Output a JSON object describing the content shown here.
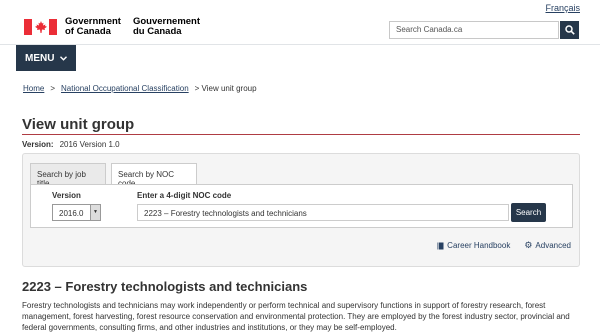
{
  "header": {
    "language_link": "Français",
    "brand_en_line1": "Government",
    "brand_en_line2": "of Canada",
    "brand_fr_line1": "Gouvernement",
    "brand_fr_line2": "du Canada",
    "search_placeholder": "Search Canada.ca",
    "search_icon": "magnifier-icon",
    "menu_label": "MENU"
  },
  "breadcrumb": {
    "home": "Home",
    "noc": "National Occupational Classification",
    "current": "View unit group",
    "separator": ">"
  },
  "page": {
    "title": "View unit group",
    "version_label": "Version:",
    "version_value": "2016 Version 1.0"
  },
  "search_panel": {
    "tabs": [
      {
        "label": "Search by job title",
        "active": false
      },
      {
        "label": "Search by NOC code",
        "active": true
      }
    ],
    "version_label": "Version",
    "version_selected": "2016.0",
    "noc_label": "Enter a 4-digit NOC code",
    "noc_value": "2223 – Forestry technologists and technicians",
    "search_button": "Search",
    "career_handbook": "Career Handbook",
    "advanced": "Advanced"
  },
  "unit_group": {
    "title": "2223 – Forestry technologists and technicians",
    "description": "Forestry technologists and technicians may work independently or perform technical and supervisory functions in support of forestry research, forest management, forest harvesting, forest resource conservation and environmental protection. They are employed by the forest industry sector, provincial and federal governments, consulting firms, and other industries and institutions, or they may be self-employed."
  },
  "colors": {
    "header_navy": "#26374a",
    "link": "#284162",
    "title_rule": "#af3c43",
    "flag_red": "#eb2d37"
  }
}
